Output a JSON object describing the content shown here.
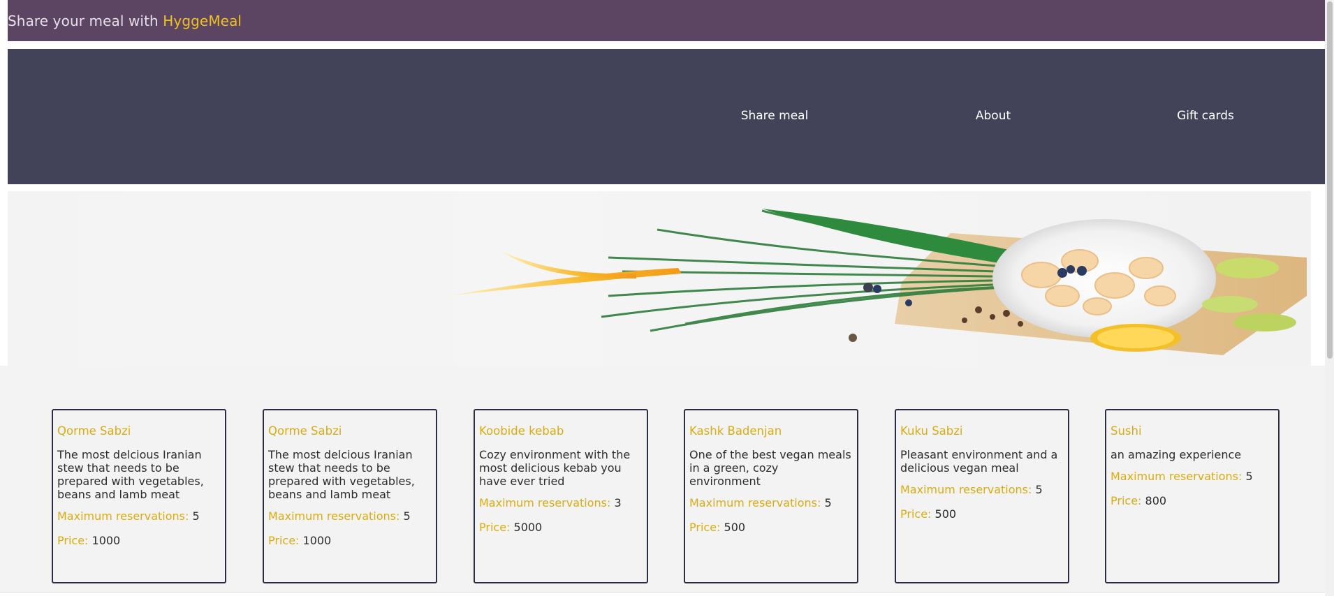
{
  "banner": {
    "prefix": "Share your meal with ",
    "brand": "HyggeMeal"
  },
  "nav": {
    "items": [
      {
        "label": "Share meal"
      },
      {
        "label": "About"
      },
      {
        "label": "Gift cards"
      }
    ]
  },
  "meals": [
    {
      "title": "Qorme Sabzi",
      "description": "The most delcious Iranian stew that needs to be prepared with vegetables, beans and lamb meat",
      "max_label": "Maximum reservations:",
      "max_value": "5",
      "price_label": "Price:",
      "price_value": "1000"
    },
    {
      "title": "Qorme Sabzi",
      "description": "The most delcious Iranian stew that needs to be prepared with vegetables, beans and lamb meat",
      "max_label": "Maximum reservations:",
      "max_value": "5",
      "price_label": "Price:",
      "price_value": "1000"
    },
    {
      "title": "Koobide kebab",
      "description": "Cozy environment with the most delicious kebab you have ever tried",
      "max_label": "Maximum reservations:",
      "max_value": "3",
      "price_label": "Price:",
      "price_value": "5000"
    },
    {
      "title": "Kashk Badenjan",
      "description": "One of the best vegan meals in a green, cozy environment",
      "max_label": "Maximum reservations:",
      "max_value": "5",
      "price_label": "Price:",
      "price_value": "500"
    },
    {
      "title": "Kuku Sabzi",
      "description": "Pleasant environment and a delicious vegan meal",
      "max_label": "Maximum reservations:",
      "max_value": "5",
      "price_label": "Price:",
      "price_value": "500"
    },
    {
      "title": "Sushi",
      "description": "an amazing experience",
      "max_label": "Maximum reservations:",
      "max_value": "5",
      "price_label": "Price:",
      "price_value": "800"
    }
  ],
  "colors": {
    "banner_bg": "#5b4563",
    "nav_bg": "#424358",
    "accent": "#d9ac12",
    "card_border": "#2b2d42"
  }
}
